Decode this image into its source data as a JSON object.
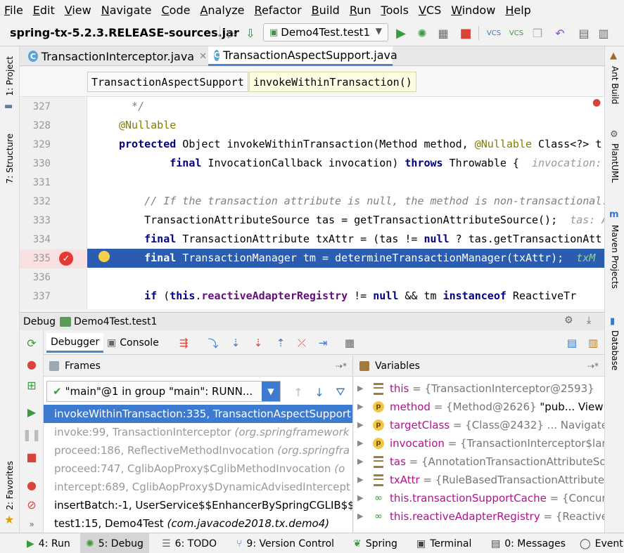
{
  "menu": [
    "File",
    "Edit",
    "View",
    "Navigate",
    "Code",
    "Analyze",
    "Refactor",
    "Build",
    "Run",
    "Tools",
    "VCS",
    "Window",
    "Help"
  ],
  "toolbar": {
    "project": "spring-tx-5.2.3.RELEASE-sources.jar",
    "run_config": "Demo4Test.test1",
    "icons": [
      "build-icon",
      "run-icon",
      "debug-icon",
      "coverage-icon",
      "stop-icon",
      "vcs-update-icon",
      "vcs-commit-icon",
      "history-icon",
      "revert-icon"
    ]
  },
  "left_strip": {
    "project": "1: Project",
    "structure": "7: Structure",
    "favorites": "2: Favorites"
  },
  "right_strip": {
    "ant": "Ant Build",
    "plantuml": "PlantUML",
    "maven": "Maven Projects",
    "database": "Database"
  },
  "tabs": [
    {
      "label": "TransactionInterceptor.java",
      "active": false
    },
    {
      "label": "TransactionAspectSupport.java",
      "active": true
    }
  ],
  "code_crumb": [
    "TransactionAspectSupport",
    "invokeWithinTransaction()"
  ],
  "code": {
    "lines": [
      327,
      328,
      329,
      330,
      331,
      332,
      333,
      334,
      335,
      336,
      337
    ],
    "highlight_line": 335
  },
  "debug": {
    "title": "Debug",
    "config": "Demo4Test.test1",
    "tab_debugger": "Debugger",
    "tab_console": "Console",
    "frames_header": "Frames",
    "thread": "\"main\"@1 in group \"main\": RUNN...",
    "frames": [
      {
        "method": "invokeWithinTransaction:335, TransactionAspectSupport",
        "pkg": "",
        "state": "selected"
      },
      {
        "method": "invoke:99, TransactionInterceptor",
        "pkg": "(org.springframework",
        "state": "lib"
      },
      {
        "method": "proceed:186, ReflectiveMethodInvocation",
        "pkg": "(org.springfra",
        "state": "lib"
      },
      {
        "method": "proceed:747, CglibAopProxy$CglibMethodInvocation",
        "pkg": "(o",
        "state": "lib"
      },
      {
        "method": "intercept:689, CglibAopProxy$DynamicAdvisedIntercept",
        "pkg": "",
        "state": "lib"
      },
      {
        "method": "insertBatch:-1, UserService$$EnhancerBySpringCGLIB$$T",
        "pkg": "",
        "state": "user"
      },
      {
        "method": "test1:15, Demo4Test",
        "pkg": "(com.javacode2018.tx.demo4)",
        "state": "user"
      }
    ],
    "variables_header": "Variables",
    "variables": [
      {
        "icon": "field",
        "name": "this",
        "value": "= {TransactionInterceptor@2593}",
        "extra": ""
      },
      {
        "icon": "param",
        "name": "method",
        "value": "= {Method@2626}",
        "extra": " \"pub... View"
      },
      {
        "icon": "param",
        "name": "targetClass",
        "value": "= {Class@2432} ... Navigate",
        "extra": ""
      },
      {
        "icon": "param",
        "name": "invocation",
        "value": "= {TransactionInterceptor$lar",
        "extra": ""
      },
      {
        "icon": "field",
        "name": "tas",
        "value": "= {AnnotationTransactionAttributeSo",
        "extra": ""
      },
      {
        "icon": "field",
        "name": "txAttr",
        "value": "= {RuleBasedTransactionAttribute",
        "extra": ""
      },
      {
        "icon": "glass",
        "name": "this.transactionSupportCache",
        "value": "= {Concur",
        "extra": ""
      },
      {
        "icon": "glass",
        "name": "this.reactiveAdapterRegistry",
        "value": "= {Reactive/",
        "extra": ""
      }
    ]
  },
  "bottom": [
    {
      "label": "4: Run",
      "icon": "run-icon"
    },
    {
      "label": "5: Debug",
      "icon": "debug-icon",
      "active": true
    },
    {
      "label": "6: TODO",
      "icon": "todo-icon"
    },
    {
      "label": "9: Version Control",
      "icon": "vcs-icon"
    },
    {
      "label": "Spring",
      "icon": "spring-icon"
    },
    {
      "label": "Terminal",
      "icon": "terminal-icon"
    },
    {
      "label": "0: Messages",
      "icon": "messages-icon"
    },
    {
      "label": "Event",
      "icon": "event-icon"
    }
  ],
  "colors": {
    "selection": "#3d7bd0",
    "exec_line": "#2a5db0",
    "keyword": "#000080",
    "annotation": "#808000",
    "var_name": "#b0128f"
  }
}
